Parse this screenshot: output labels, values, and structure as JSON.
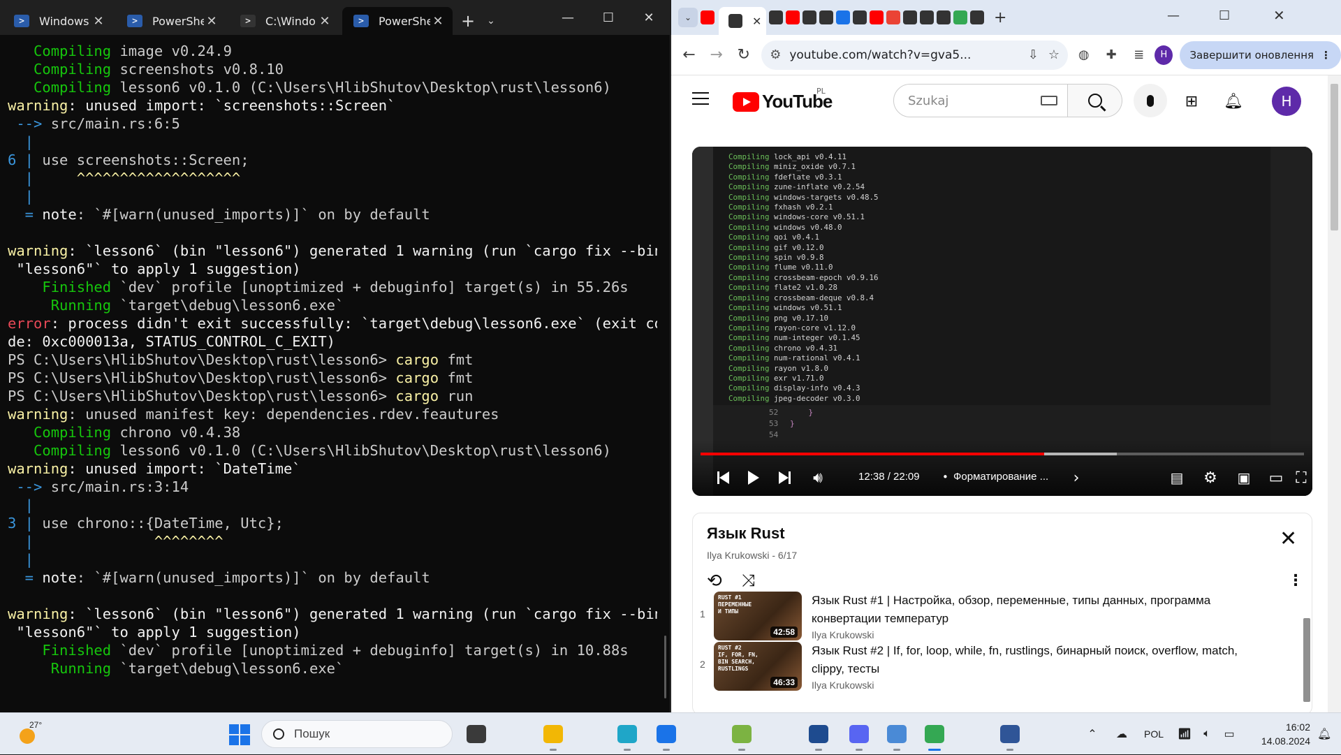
{
  "terminal": {
    "tabs": [
      {
        "label": "Windows",
        "active": false
      },
      {
        "label": "PowerShe",
        "active": false
      },
      {
        "label": "C:\\Windo",
        "active": false
      },
      {
        "label": "PowerShe",
        "active": true
      }
    ],
    "new_tab_label": "+",
    "dropdown_label": "⌄",
    "minimize_label": "—",
    "maximize_label": "☐",
    "close_label": "✕",
    "lines": [
      [
        {
          "t": "   ",
          "c": ""
        },
        {
          "t": "Compiling",
          "c": "g"
        },
        {
          "t": " image v0.24.9",
          "c": ""
        }
      ],
      [
        {
          "t": "   ",
          "c": ""
        },
        {
          "t": "Compiling",
          "c": "g"
        },
        {
          "t": " screenshots v0.8.10",
          "c": ""
        }
      ],
      [
        {
          "t": "   ",
          "c": ""
        },
        {
          "t": "Compiling",
          "c": "g"
        },
        {
          "t": " lesson6 v0.1.0 (C:\\Users\\HlibShutov\\Desktop\\rust\\lesson6)",
          "c": ""
        }
      ],
      [
        {
          "t": "warning",
          "c": "y"
        },
        {
          "t": ": unused import: `screenshots::Screen`",
          "c": "w"
        }
      ],
      [
        {
          "t": " --> ",
          "c": "c"
        },
        {
          "t": "src/main.rs:6:5",
          "c": ""
        }
      ],
      [
        {
          "t": "  |",
          "c": "c"
        }
      ],
      [
        {
          "t": "6 |",
          "c": "c"
        },
        {
          "t": " use screenshots::Screen;",
          "c": ""
        }
      ],
      [
        {
          "t": "  |",
          "c": "c"
        },
        {
          "t": "     ^^^^^^^^^^^^^^^^^^^",
          "c": "y"
        }
      ],
      [
        {
          "t": "  |",
          "c": "c"
        }
      ],
      [
        {
          "t": "  = ",
          "c": "c"
        },
        {
          "t": "note",
          "c": "w"
        },
        {
          "t": ": `#[warn(unused_imports)]` on by default",
          "c": ""
        }
      ],
      [
        {
          "t": "",
          "c": ""
        }
      ],
      [
        {
          "t": "warning",
          "c": "y"
        },
        {
          "t": ": `lesson6` (bin \"lesson6\") generated 1 warning (run `cargo fix --bin",
          "c": "w"
        }
      ],
      [
        {
          "t": " \"lesson6\"` to apply 1 suggestion)",
          "c": "w"
        }
      ],
      [
        {
          "t": "    ",
          "c": ""
        },
        {
          "t": "Finished",
          "c": "g"
        },
        {
          "t": " `dev` profile [unoptimized + debuginfo] target(s) in 55.26s",
          "c": ""
        }
      ],
      [
        {
          "t": "     ",
          "c": ""
        },
        {
          "t": "Running",
          "c": "g"
        },
        {
          "t": " `target\\debug\\lesson6.exe`",
          "c": ""
        }
      ],
      [
        {
          "t": "error",
          "c": "r"
        },
        {
          "t": ": process didn't exit successfully: `target\\debug\\lesson6.exe` (exit co",
          "c": "w"
        }
      ],
      [
        {
          "t": "de: 0xc000013a, STATUS_CONTROL_C_EXIT)",
          "c": "w"
        }
      ],
      [
        {
          "t": "PS C:\\Users\\HlibShutov\\Desktop\\rust\\lesson6> ",
          "c": ""
        },
        {
          "t": "cargo",
          "c": "y"
        },
        {
          "t": " fmt",
          "c": ""
        }
      ],
      [
        {
          "t": "PS C:\\Users\\HlibShutov\\Desktop\\rust\\lesson6> ",
          "c": ""
        },
        {
          "t": "cargo",
          "c": "y"
        },
        {
          "t": " fmt",
          "c": ""
        }
      ],
      [
        {
          "t": "PS C:\\Users\\HlibShutov\\Desktop\\rust\\lesson6> ",
          "c": ""
        },
        {
          "t": "cargo",
          "c": "y"
        },
        {
          "t": " run",
          "c": ""
        }
      ],
      [
        {
          "t": "warning",
          "c": "y"
        },
        {
          "t": ": unused manifest key: dependencies.rdev.feautures",
          "c": ""
        }
      ],
      [
        {
          "t": "   ",
          "c": ""
        },
        {
          "t": "Compiling",
          "c": "g"
        },
        {
          "t": " chrono v0.4.38",
          "c": ""
        }
      ],
      [
        {
          "t": "   ",
          "c": ""
        },
        {
          "t": "Compiling",
          "c": "g"
        },
        {
          "t": " lesson6 v0.1.0 (C:\\Users\\HlibShutov\\Desktop\\rust\\lesson6)",
          "c": ""
        }
      ],
      [
        {
          "t": "warning",
          "c": "y"
        },
        {
          "t": ": unused import: `DateTime`",
          "c": "w"
        }
      ],
      [
        {
          "t": " --> ",
          "c": "c"
        },
        {
          "t": "src/main.rs:3:14",
          "c": ""
        }
      ],
      [
        {
          "t": "  |",
          "c": "c"
        }
      ],
      [
        {
          "t": "3 |",
          "c": "c"
        },
        {
          "t": " use chrono::{DateTime, Utc};",
          "c": ""
        }
      ],
      [
        {
          "t": "  |",
          "c": "c"
        },
        {
          "t": "              ^^^^^^^^",
          "c": "y"
        }
      ],
      [
        {
          "t": "  |",
          "c": "c"
        }
      ],
      [
        {
          "t": "  = ",
          "c": "c"
        },
        {
          "t": "note",
          "c": "w"
        },
        {
          "t": ": `#[warn(unused_imports)]` on by default",
          "c": ""
        }
      ],
      [
        {
          "t": "",
          "c": ""
        }
      ],
      [
        {
          "t": "warning",
          "c": "y"
        },
        {
          "t": ": `lesson6` (bin \"lesson6\") generated 1 warning (run `cargo fix --bin",
          "c": "w"
        }
      ],
      [
        {
          "t": " \"lesson6\"` to apply 1 suggestion)",
          "c": "w"
        }
      ],
      [
        {
          "t": "    ",
          "c": ""
        },
        {
          "t": "Finished",
          "c": "g"
        },
        {
          "t": " `dev` profile [unoptimized + debuginfo] target(s) in 10.88s",
          "c": ""
        }
      ],
      [
        {
          "t": "     ",
          "c": ""
        },
        {
          "t": "Running",
          "c": "g"
        },
        {
          "t": " `target\\debug\\lesson6.exe`",
          "c": ""
        }
      ]
    ]
  },
  "browser": {
    "url": "youtube.com/watch?v=gva5...",
    "update_button": "Завершити оновлення",
    "profile_initial": "H",
    "tab_favicons": [
      "#ff0000",
      "#333333",
      "#ff0000",
      "#333333",
      "#333333",
      "#1a73e8",
      "#333333",
      "#ff0000",
      "#ea4335",
      "#333333",
      "#333333",
      "#333333",
      "#34a853",
      "#333333"
    ],
    "youtube": {
      "logo_text": "YouTube",
      "region": "PL",
      "search_placeholder": "Szukaj",
      "avatar_initial": "H",
      "player": {
        "time": "12:38 / 22:09",
        "chapter": "Форматирование ...",
        "progress_fraction": 0.57,
        "video_terminal_lines": [
          {
            "k": "Compiling",
            "v": "lock_api v0.4.11"
          },
          {
            "k": "Compiling",
            "v": "miniz_oxide v0.7.1"
          },
          {
            "k": "Compiling",
            "v": "fdeflate v0.3.1"
          },
          {
            "k": "Compiling",
            "v": "zune-inflate v0.2.54"
          },
          {
            "k": "Compiling",
            "v": "windows-targets v0.48.5"
          },
          {
            "k": "Compiling",
            "v": "fxhash v0.2.1"
          },
          {
            "k": "Compiling",
            "v": "windows-core v0.51.1"
          },
          {
            "k": "Compiling",
            "v": "windows v0.48.0"
          },
          {
            "k": "Compiling",
            "v": "qoi v0.4.1"
          },
          {
            "k": "Compiling",
            "v": "gif v0.12.0"
          },
          {
            "k": "Compiling",
            "v": "spin v0.9.8"
          },
          {
            "k": "Compiling",
            "v": "flume v0.11.0"
          },
          {
            "k": "Compiling",
            "v": "crossbeam-epoch v0.9.16"
          },
          {
            "k": "Compiling",
            "v": "flate2 v1.0.28"
          },
          {
            "k": "Compiling",
            "v": "crossbeam-deque v0.8.4"
          },
          {
            "k": "Compiling",
            "v": "windows v0.51.1"
          },
          {
            "k": "Compiling",
            "v": "png v0.17.10"
          },
          {
            "k": "Compiling",
            "v": "rayon-core v1.12.0"
          },
          {
            "k": "Compiling",
            "v": "num-integer v0.1.45"
          },
          {
            "k": "Compiling",
            "v": "chrono v0.4.31"
          },
          {
            "k": "Compiling",
            "v": "num-rational v0.4.1"
          },
          {
            "k": "Compiling",
            "v": "rayon v1.8.0"
          },
          {
            "k": "Compiling",
            "v": "exr v1.71.0"
          },
          {
            "k": "Compiling",
            "v": "display-info v0.4.3"
          },
          {
            "k": "Compiling",
            "v": "jpeg-decoder v0.3.0"
          }
        ],
        "editor_lines": [
          {
            "num": "52",
            "code": "    }"
          },
          {
            "num": "53",
            "code": "}"
          },
          {
            "num": "54",
            "code": ""
          }
        ]
      },
      "playlist": {
        "title": "Язык Rust",
        "subtitle": "Ilya Krukowski - 6/17",
        "items": [
          {
            "index": "1",
            "thumb_text": "RUST #1\nПЕРЕМЕННЫЕ\nИ ТИПЫ",
            "duration": "42:58",
            "title": "Язык Rust #1 | Настройка, обзор, переменные, типы данных, программа конвертации температур",
            "channel": "Ilya Krukowski"
          },
          {
            "index": "2",
            "thumb_text": "RUST #2\nIF, FOR, FN,\nBIN SEARCH,\nRUSTLINGS",
            "duration": "46:33",
            "title": "Язык Rust #2 | If, for, loop, while, fn, rustlings, бинарный поиск, overflow, match, clippy, тесты",
            "channel": "Ilya Krukowski"
          }
        ]
      }
    }
  },
  "taskbar": {
    "weather_temp": "27°",
    "search_placeholder": "Пошук",
    "language": "POL",
    "time": "16:02",
    "date": "14.08.2024",
    "apps": [
      {
        "name": "task-view",
        "color": "#3a3a3a"
      },
      {
        "name": "file-explorer",
        "color": "#f2b705"
      },
      {
        "name": "edge",
        "color": "#1fa6c8"
      },
      {
        "name": "blue-app",
        "color": "#1a73e8"
      },
      {
        "name": "notepad-plus",
        "color": "#7cb342"
      },
      {
        "name": "virtualbox",
        "color": "#1e4b8f"
      },
      {
        "name": "discord",
        "color": "#5865f2"
      },
      {
        "name": "monitor-app",
        "color": "#4a8ad6"
      },
      {
        "name": "chrome",
        "color": "#34a853"
      },
      {
        "name": "network-app",
        "color": "#2f5597"
      }
    ]
  }
}
